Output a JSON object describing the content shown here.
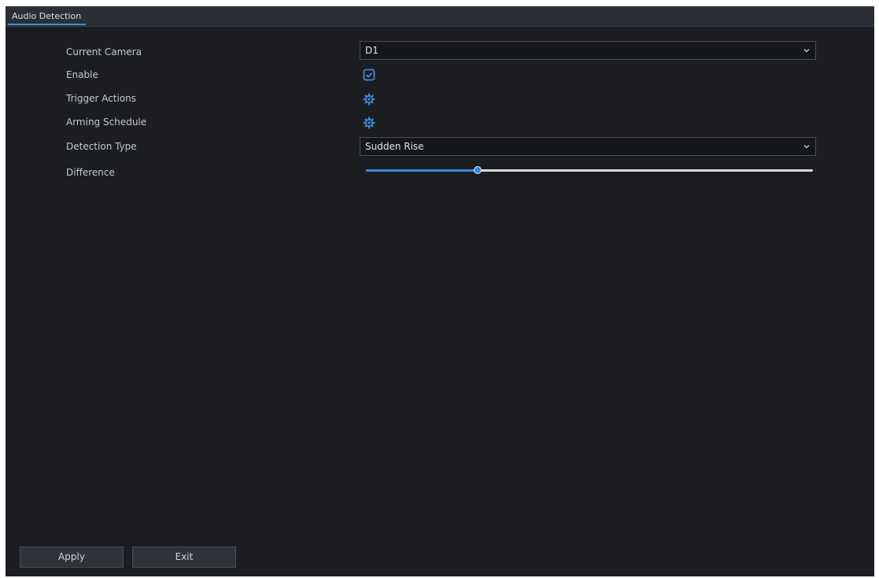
{
  "tabs": [
    {
      "label": "Audio Detection",
      "active": true
    }
  ],
  "form": {
    "current_camera": {
      "label": "Current Camera",
      "value": "D1"
    },
    "enable": {
      "label": "Enable",
      "checked": true
    },
    "trigger_actions": {
      "label": "Trigger Actions",
      "icon": "gear-icon"
    },
    "arming_schedule": {
      "label": "Arming Schedule",
      "icon": "gear-icon"
    },
    "detection_type": {
      "label": "Detection Type",
      "value": "Sudden Rise"
    },
    "difference": {
      "label": "Difference",
      "level_percent": 25
    }
  },
  "buttons": {
    "apply": "Apply",
    "exit": "Exit"
  },
  "colors": {
    "background": "#1b1d21",
    "accent": "#3d8bd9",
    "text": "#c5c8ce",
    "input_background": "#15171a"
  }
}
